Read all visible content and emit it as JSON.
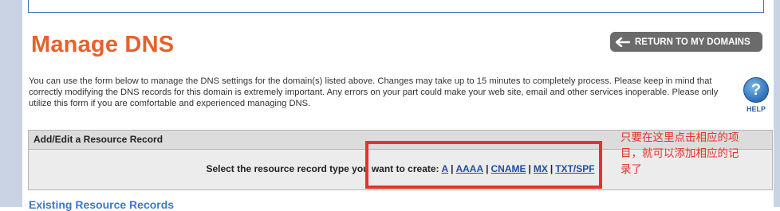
{
  "header": {
    "title": "Manage DNS",
    "return_label": "RETURN TO MY DOMAINS"
  },
  "intro": "You can use the form below to manage the DNS settings for the domain(s) listed above. Changes may take up to 15 minutes to completely process. Please keep in mind that correctly modifying the DNS records for this domain is extremely important. Any errors on your part could make your web site, email and other services inoperable. Please only utilize this form if you are comfortable and experienced managing DNS.",
  "help": {
    "icon_char": "?",
    "label": "HELP"
  },
  "record_panel": {
    "header": "Add/Edit a Resource Record",
    "prompt": "Select the resource record type you want to create:",
    "types": [
      "A",
      "AAAA",
      "CNAME",
      "MX",
      "TXT/SPF"
    ],
    "separator": "|"
  },
  "annotation": "只要在这里点击相应的项目，就可以添加相应的记录了",
  "existing": {
    "title": "Existing Resource Records"
  },
  "colors": {
    "title": "#e8602c",
    "button_bg": "#6b6b6b",
    "link": "#1d4f9c",
    "annotation": "#e4322b"
  }
}
